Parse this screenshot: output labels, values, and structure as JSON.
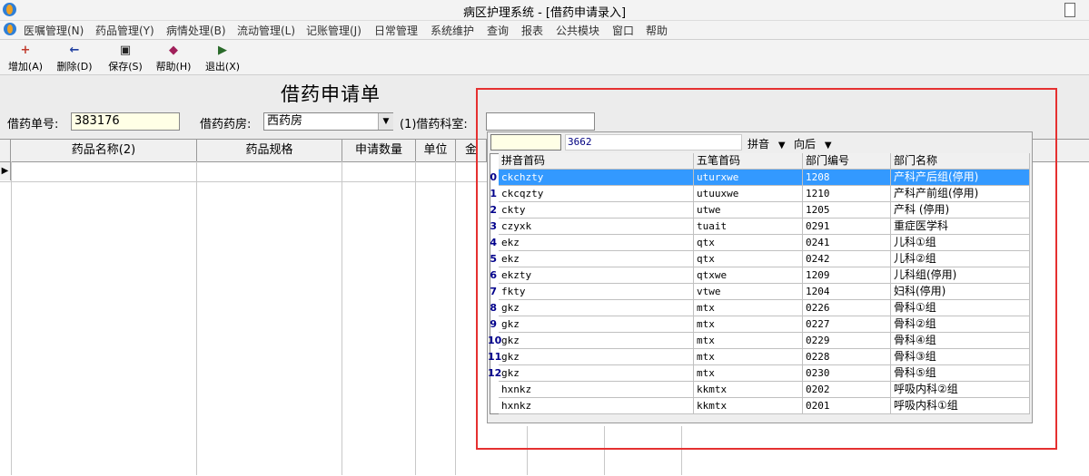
{
  "window": {
    "title": "病区护理系统 - [借药申请录入]"
  },
  "menu": [
    "医嘱管理(N)",
    "药品管理(Y)",
    "病情处理(B)",
    "流动管理(L)",
    "记账管理(J)",
    "日常管理",
    "系统维护",
    "查询",
    "报表",
    "公共模块",
    "窗口",
    "帮助"
  ],
  "toolbar": [
    {
      "label": "增加(A)",
      "icon": "add-icon"
    },
    {
      "label": "删除(D)",
      "icon": "delete-icon"
    },
    {
      "label": "保存(S)",
      "icon": "save-icon"
    },
    {
      "label": "帮助(H)",
      "icon": "help-book-icon"
    },
    {
      "label": "退出(X)",
      "icon": "exit-icon"
    }
  ],
  "form": {
    "title": "借药申请单",
    "order_no_label": "借药单号:",
    "order_no": "383176",
    "pharmacy_label": "借药药房:",
    "pharmacy": "西药房",
    "dept_label": "(1)借药科室:",
    "dept_value": ""
  },
  "grid": {
    "columns": [
      "药品名称(2)",
      "药品规格",
      "申请数量",
      "单位",
      "金"
    ]
  },
  "popup": {
    "search_value": "",
    "count": "3662",
    "mode": "拼音",
    "direction": "向后",
    "columns": [
      "拼音首码",
      "五笔首码",
      "部门编号",
      "部门名称"
    ],
    "rows": [
      {
        "n": "0",
        "py": "ckchzty",
        "wb": "uturxwe",
        "code": "1208",
        "name": "产科产后组(停用)"
      },
      {
        "n": "1",
        "py": "ckcqzty",
        "wb": "utuuxwe",
        "code": "1210",
        "name": "产科产前组(停用)"
      },
      {
        "n": "2",
        "py": "ckty",
        "wb": "utwe",
        "code": "1205",
        "name": "产科 (停用)"
      },
      {
        "n": "3",
        "py": "czyxk",
        "wb": "tuait",
        "code": "0291",
        "name": "重症医学科"
      },
      {
        "n": "4",
        "py": "ekz",
        "wb": "qtx",
        "code": "0241",
        "name": "儿科①组"
      },
      {
        "n": "5",
        "py": "ekz",
        "wb": "qtx",
        "code": "0242",
        "name": "儿科②组"
      },
      {
        "n": "6",
        "py": "ekzty",
        "wb": "qtxwe",
        "code": "1209",
        "name": "儿科组(停用)"
      },
      {
        "n": "7",
        "py": "fkty",
        "wb": "vtwe",
        "code": "1204",
        "name": "妇科(停用)"
      },
      {
        "n": "8",
        "py": "gkz",
        "wb": "mtx",
        "code": "0226",
        "name": "骨科①组"
      },
      {
        "n": "9",
        "py": "gkz",
        "wb": "mtx",
        "code": "0227",
        "name": "骨科②组"
      },
      {
        "n": "10",
        "py": "gkz",
        "wb": "mtx",
        "code": "0229",
        "name": "骨科④组"
      },
      {
        "n": "11",
        "py": "gkz",
        "wb": "mtx",
        "code": "0228",
        "name": "骨科③组"
      },
      {
        "n": "12",
        "py": "gkz",
        "wb": "mtx",
        "code": "0230",
        "name": "骨科⑤组"
      },
      {
        "n": "",
        "py": "hxnkz",
        "wb": "kkmtx",
        "code": "0202",
        "name": "呼吸内科②组"
      },
      {
        "n": "",
        "py": "hxnkz",
        "wb": "kkmtx",
        "code": "0201",
        "name": "呼吸内科①组"
      }
    ]
  },
  "colors": {
    "selected_row": "#3399ff",
    "highlight_box": "#e53030"
  }
}
